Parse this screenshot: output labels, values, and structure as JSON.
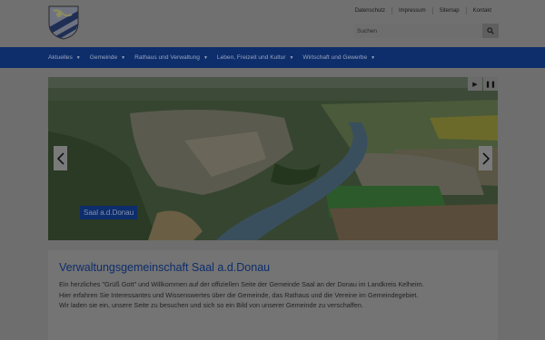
{
  "header": {
    "logo_icon": "coat-of-arms-icon",
    "top_links": [
      {
        "label": "Datenschutz"
      },
      {
        "label": "Impressum"
      },
      {
        "label": "Sitemap"
      },
      {
        "label": "Kontakt"
      }
    ],
    "search": {
      "placeholder": "Suchen",
      "button_icon": "search-icon"
    }
  },
  "mainnav": {
    "items": [
      {
        "label": "Aktuelles"
      },
      {
        "label": "Gemeinde"
      },
      {
        "label": "Rathaus und Verwaltung"
      },
      {
        "label": "Leben, Freizeit und Kultur"
      },
      {
        "label": "Wirtschaft und Gewerbe"
      }
    ],
    "color": "#0d2d6b"
  },
  "slider": {
    "caption": "Saal a.d.Donau",
    "play_icon": "play-icon",
    "pause_icon": "pause-icon",
    "prev_icon": "chevron-left-icon",
    "next_icon": "chevron-right-icon"
  },
  "content": {
    "title": "Verwaltungsgemeinschaft Saal a.d.Donau",
    "lines": [
      "Ein herzliches \"Grüß Gott\" und Willkommen auf der offiziellen Seite der Gemeinde Saal an der Donau im Landkreis Kelheim.",
      "Hier erfahren Sie Interessantes und Wissenswertes über die Gemeinde, das Rathaus und die Vereine im Gemeindegebiet.",
      "Wir laden sie ein, unsere Seite zu besuchen und sich so ein Bild von unserer Gemeinde zu verschaffen."
    ]
  }
}
